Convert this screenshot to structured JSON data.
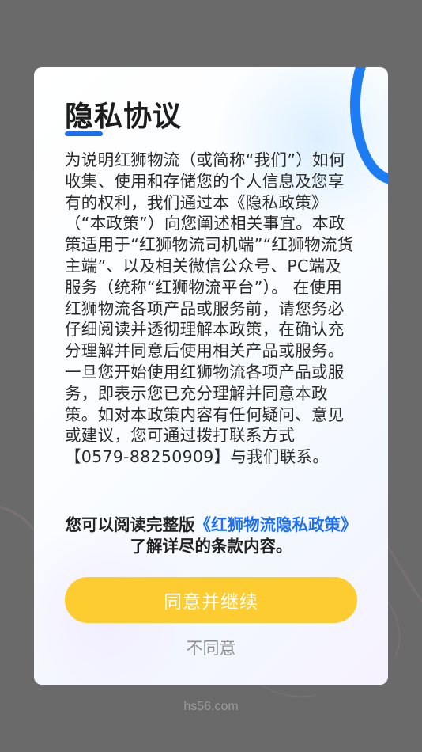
{
  "dialog": {
    "title": "隐私协议",
    "body": "为说明红狮物流（或简称“我们”）如何收集、使用和存储您的个人信息及您享有的权利，我们通过本《隐私政策》（“本政策”）向您阐述相关事宜。本政策适用于“红狮物流司机端”“红狮物流货主端”、以及相关微信公众号、PC端及服务（统称“红狮物流平台”）。 在使用红狮物流各项产品或服务前，请您务必仔细阅读并透彻理解本政策，在确认充分理解并同意后使用相关产品或服务。一旦您开始使用红狮物流各项产品或服务，即表示您已充分理解并同意本政策。如对本政策内容有任何疑问、意见或建议，您可通过拨打联系方式【0579-88250909】与我们联系。",
    "notice_prefix": "您可以阅读完整版",
    "notice_link": "《红狮物流隐私政策》",
    "notice_suffix": "了解详尽的条款内容。",
    "agree_label": "同意并继续",
    "disagree_label": "不同意"
  },
  "footer": {
    "brand": "hs56.com"
  },
  "colors": {
    "overlay": "#6a6a6a",
    "accent_blue": "#1d6ff2",
    "agree_button": "#fdcc30",
    "title_text": "#1c1c1c",
    "disagree_text": "#8e8e8e"
  }
}
